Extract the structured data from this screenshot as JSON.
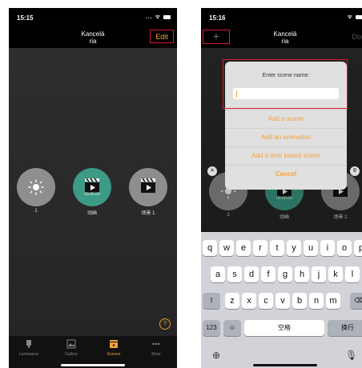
{
  "left": {
    "time": "15:15",
    "status_icons": "... ᯤ",
    "nav_title_line1": "Kancelá",
    "nav_title_line2": "ria",
    "edit_label": "Edit",
    "scenes": [
      {
        "label": "1"
      },
      {
        "label": "动画",
        "time": "00:00:00"
      },
      {
        "label": "场景 1"
      }
    ],
    "help_symbol": "?",
    "tabs": [
      {
        "label": "Luminaires"
      },
      {
        "label": "Gallery"
      },
      {
        "label": "Scenes"
      },
      {
        "label": "More"
      }
    ]
  },
  "right": {
    "time": "15:16",
    "status_icons": "ᯤ",
    "nav_title_line1": "Kancelá",
    "nav_title_line2": "ria",
    "plus_label": "+",
    "done_label": "Done",
    "dialog": {
      "prompt": "Enter scene name:",
      "items": [
        "Add a scene",
        "Add an animation",
        "Add a time based scene",
        "Cancel"
      ]
    },
    "scenes": [
      {
        "label": "1"
      },
      {
        "label": "动画",
        "time": "00:00:00"
      },
      {
        "label": "场景 1"
      }
    ],
    "badge_x": "×",
    "badge_zero": "0",
    "keyboard": {
      "row1": [
        "q",
        "w",
        "e",
        "r",
        "t",
        "y",
        "u",
        "i",
        "o",
        "p"
      ],
      "row2": [
        "a",
        "s",
        "d",
        "f",
        "g",
        "h",
        "j",
        "k",
        "l"
      ],
      "row3": [
        "z",
        "x",
        "c",
        "v",
        "b",
        "n",
        "m"
      ],
      "shift": "⇧",
      "backspace": "⌫",
      "numbers": "123",
      "emoji": "☺",
      "space": "空格",
      "return": "换行",
      "globe": "⊕",
      "mic": "🎙"
    }
  },
  "colors": {
    "accent": "#f2a23c",
    "highlight": "#d81b2b",
    "scene_teal": "#3d9a84"
  }
}
